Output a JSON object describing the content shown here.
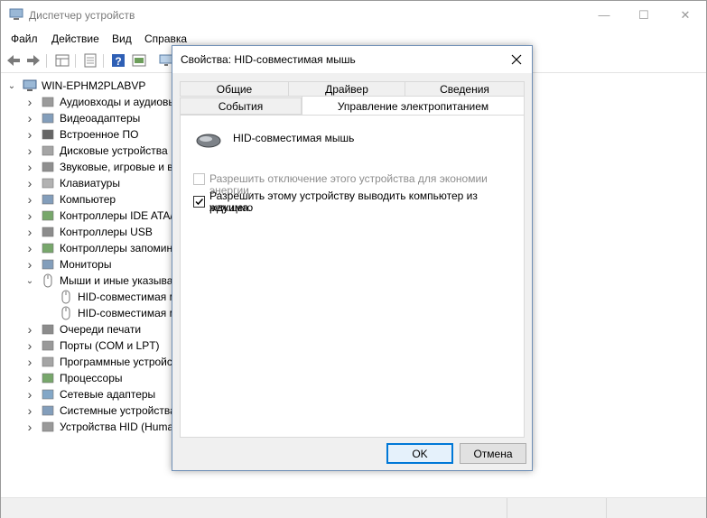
{
  "window": {
    "title": "Диспетчер устройств",
    "controls": {
      "minimize": "—",
      "maximize": "☐",
      "close": "✕"
    }
  },
  "menu": [
    "Файл",
    "Действие",
    "Вид",
    "Справка"
  ],
  "tree": {
    "root": "WIN-EPHM2PLABVP",
    "items": [
      {
        "label": "Аудиовходы и аудиовыходы",
        "icon": "audio-icon"
      },
      {
        "label": "Видеоадаптеры",
        "icon": "display-adapter-icon"
      },
      {
        "label": "Встроенное ПО",
        "icon": "firmware-icon"
      },
      {
        "label": "Дисковые устройства",
        "icon": "disk-drive-icon"
      },
      {
        "label": "Звуковые, игровые и видеоустройства",
        "icon": "sound-icon"
      },
      {
        "label": "Клавиатуры",
        "icon": "keyboard-icon"
      },
      {
        "label": "Компьютер",
        "icon": "computer-icon"
      },
      {
        "label": "Контроллеры IDE ATA/ATAPI",
        "icon": "ide-controller-icon"
      },
      {
        "label": "Контроллеры USB",
        "icon": "usb-icon"
      },
      {
        "label": "Контроллеры запоминающих устройств",
        "icon": "storage-controller-icon"
      },
      {
        "label": "Мониторы",
        "icon": "monitor-icon"
      },
      {
        "label": "Мыши и иные указывающие устройства",
        "icon": "mouse-icon",
        "expanded": true
      },
      {
        "label": "HID-совместимая мышь",
        "icon": "mouse-icon",
        "child": true
      },
      {
        "label": "HID-совместимая мышь",
        "icon": "mouse-icon",
        "child": true
      },
      {
        "label": "Очереди печати",
        "icon": "printer-icon"
      },
      {
        "label": "Порты (COM и LPT)",
        "icon": "port-icon"
      },
      {
        "label": "Программные устройства",
        "icon": "software-device-icon"
      },
      {
        "label": "Процессоры",
        "icon": "processor-icon"
      },
      {
        "label": "Сетевые адаптеры",
        "icon": "network-adapter-icon"
      },
      {
        "label": "Системные устройства",
        "icon": "system-device-icon"
      },
      {
        "label": "Устройства HID (Human Interface Devices)",
        "icon": "hid-icon"
      }
    ]
  },
  "dialog": {
    "title": "Свойства: HID-совместимая мышь",
    "tabs_back": [
      "Общие",
      "Драйвер",
      "Сведения"
    ],
    "tabs_front": [
      "События",
      "Управление электропитанием"
    ],
    "active_tab": "Управление электропитанием",
    "device_name": "HID-совместимая мышь",
    "option1": {
      "label": "Разрешить отключение этого устройства для экономии энергии.",
      "checked": false,
      "enabled": false
    },
    "option2": {
      "label_line1": "Разрешить этому устройству выводить компьютер из ждущего",
      "label_line2": "режима.",
      "checked": true,
      "enabled": true
    },
    "ok": "OK",
    "cancel": "Отмена"
  },
  "colors": {
    "accent": "#0078d7",
    "dialog_border": "#6f8fb6",
    "disabled_text": "#8d8d8d"
  }
}
